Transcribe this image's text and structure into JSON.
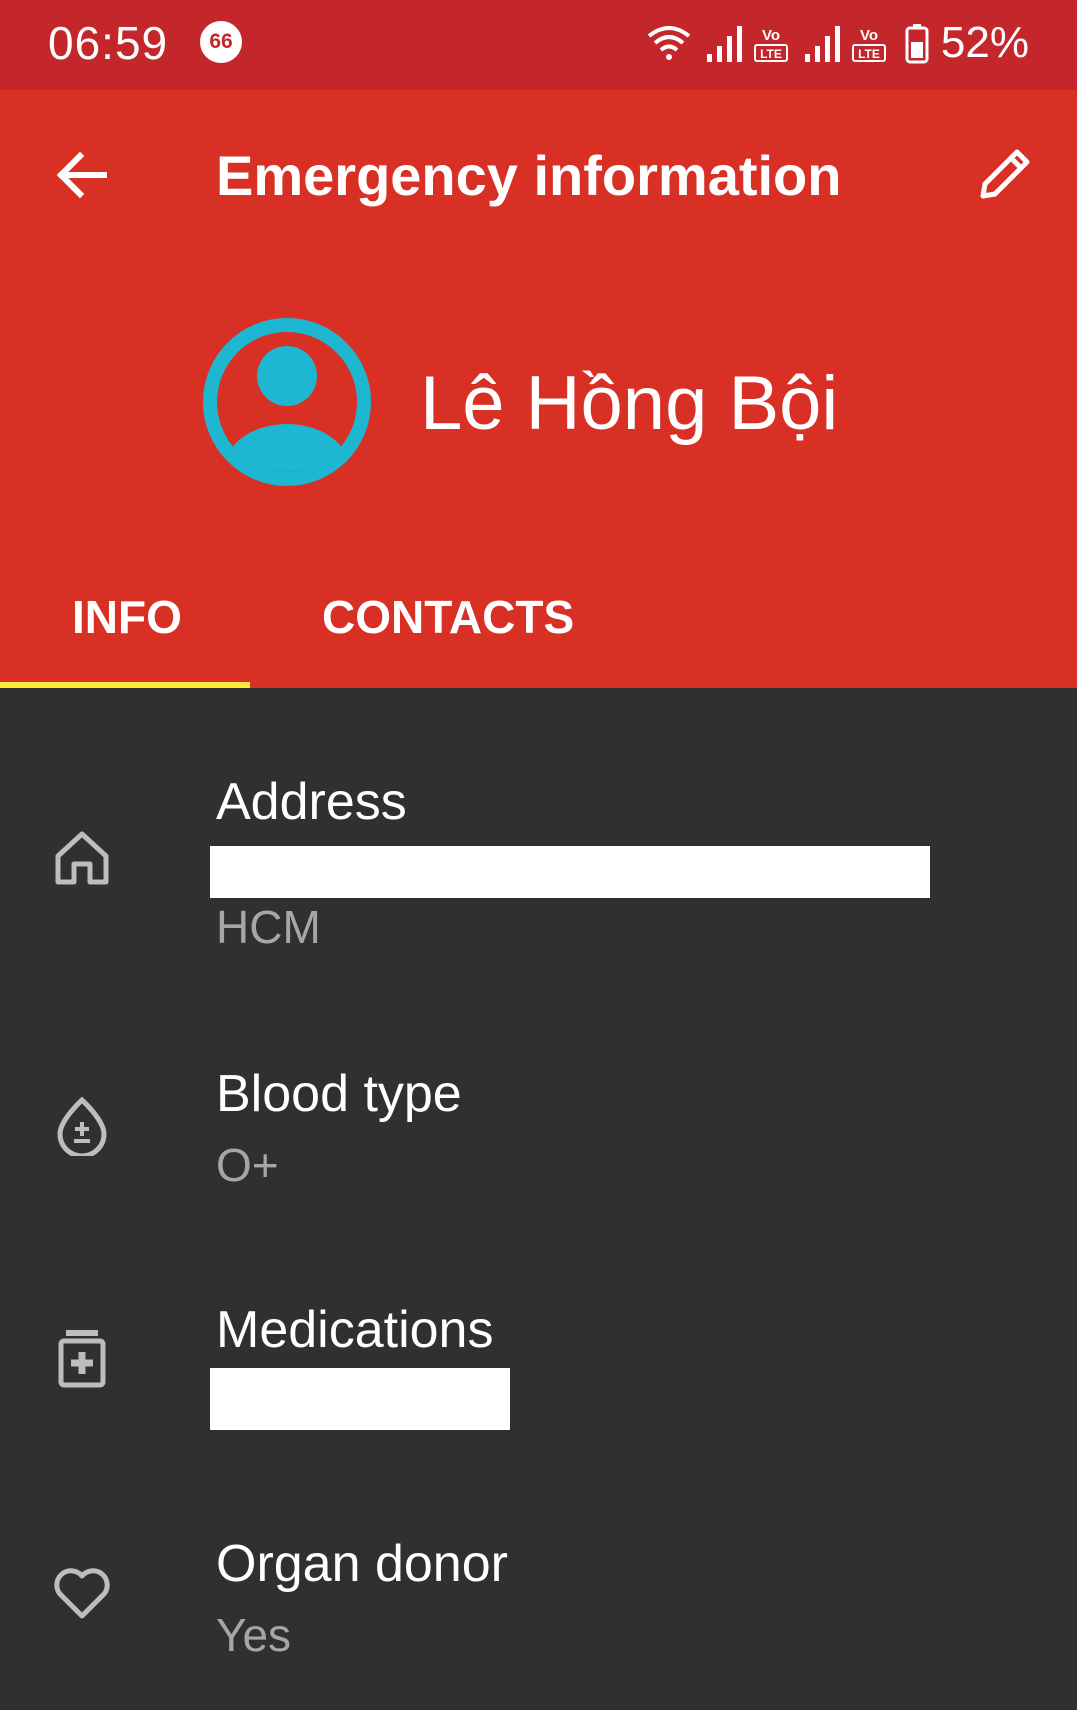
{
  "status_bar": {
    "time": "06:59",
    "notification_badge": "66",
    "icons": [
      "wifi-icon",
      "signal-icon",
      "volte-icon",
      "signal-icon",
      "volte-icon",
      "battery-icon"
    ],
    "volte_label_top": "Vo",
    "volte_label_bottom": "LTE",
    "battery_percent": "52%"
  },
  "app_bar": {
    "title": "Emergency information",
    "back_icon": "arrow-back-icon",
    "edit_icon": "pencil-icon"
  },
  "profile": {
    "name": "Lê Hồng Bội",
    "avatar_icon": "account-circle-icon"
  },
  "tabs": [
    {
      "label": "INFO",
      "selected": true
    },
    {
      "label": "CONTACTS",
      "selected": false
    }
  ],
  "info_items": [
    {
      "label": "Address",
      "value": "HCM",
      "icon": "home-icon",
      "redacted": true
    },
    {
      "label": "Blood type",
      "value": "O+",
      "icon": "blood-drop-icon"
    },
    {
      "label": "Medications",
      "value": "",
      "icon": "medication-icon",
      "redacted": true
    },
    {
      "label": "Organ donor",
      "value": "Yes",
      "icon": "heart-outline-icon"
    }
  ],
  "colors": {
    "status_bar": "#c4272b",
    "app_bar": "#d93026",
    "tab_indicator": "#ffeb3b",
    "content_background": "#303030",
    "avatar": "#1eb7d2",
    "secondary_text": "#a6a6a6",
    "icon_gray": "#bdbdbd"
  }
}
